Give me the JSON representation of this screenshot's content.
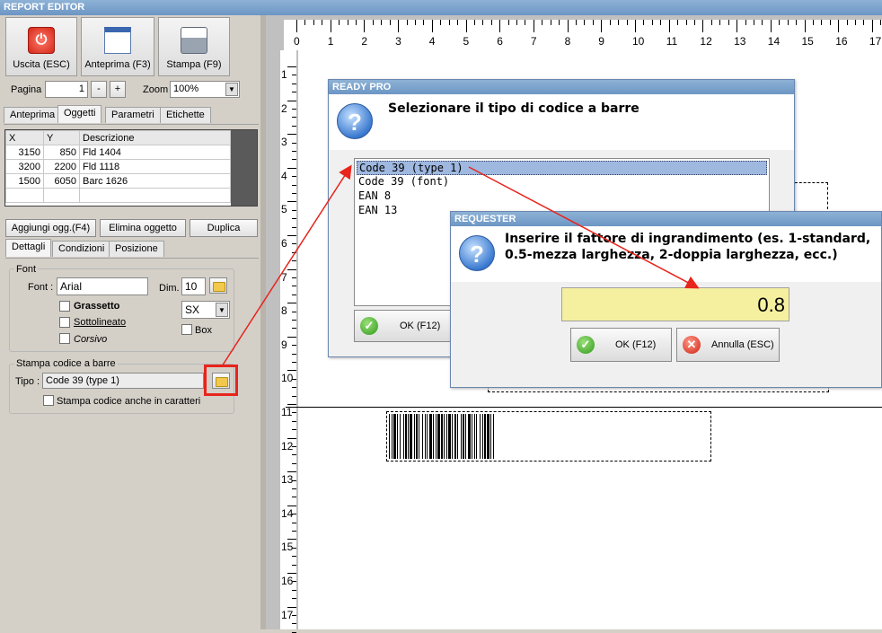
{
  "app": {
    "title": "REPORT EDITOR"
  },
  "toolbar": {
    "exit_label": "Uscita (ESC)",
    "preview_label": "Anteprima (F3)",
    "print_label": "Stampa (F9)",
    "page_label": "Pagina",
    "page_value": "1",
    "minus": "-",
    "plus": "+",
    "zoom_label": "Zoom",
    "zoom_value": "100%"
  },
  "tabs1": [
    "Anteprima",
    "Oggetti",
    "Parametri",
    "Etichette"
  ],
  "objects_table": {
    "headers": [
      "X",
      "Y",
      "Descrizione"
    ],
    "rows": [
      [
        "3150",
        "850",
        "Fld 1404"
      ],
      [
        "3200",
        "2200",
        "Fld 1118"
      ],
      [
        "1500",
        "6050",
        "Barc 1626"
      ]
    ]
  },
  "obj_buttons": {
    "add": "Aggiungi ogg.(F4)",
    "delete": "Elimina oggetto",
    "duplicate": "Duplica"
  },
  "tabs2": [
    "Dettagli",
    "Condizioni",
    "Posizione"
  ],
  "font_group": {
    "title": "Font",
    "font_label": "Font :",
    "font_value": "Arial",
    "dim_label": "Dim.",
    "dim_value": "10",
    "bold": "Grassetto",
    "underline": "Sottolineato",
    "italic": "Corsivo",
    "align_value": "SX",
    "box": "Box"
  },
  "barcode_group": {
    "title": "Stampa codice a barre",
    "type_label": "Tipo :",
    "type_value": "Code 39 (type 1)",
    "print_chars": "Stampa codice anche in caratteri"
  },
  "ruler": {
    "top": [
      "0",
      "1",
      "2",
      "3",
      "4",
      "5",
      "6",
      "7",
      "8",
      "9",
      "10",
      "11",
      "12",
      "13",
      "14",
      "15",
      "16",
      "17"
    ],
    "left": [
      "1",
      "2",
      "3",
      "4",
      "5",
      "6",
      "7",
      "8",
      "9",
      "10",
      "11",
      "12",
      "13",
      "14",
      "15",
      "16",
      "17"
    ]
  },
  "dialog1": {
    "title": "READY PRO",
    "message": "Selezionare il tipo di codice a barre",
    "options": [
      "Code 39 (type 1)",
      "Code 39 (font)",
      "EAN 8",
      "EAN 13"
    ],
    "ok": "OK (F12)"
  },
  "dialog2": {
    "title": "REQUESTER",
    "message_line1": "Inserire il fattore di ingrandimento (es. 1-standard,",
    "message_line2": "0.5-mezza larghezza, 2-doppia larghezza, ecc.)",
    "value": "0.8",
    "ok": "OK (F12)",
    "cancel": "Annulla (ESC)"
  },
  "colors": {
    "highlight": "#e8241c",
    "selection": "#9fb8e0",
    "input_yellow": "#f4f0a0"
  }
}
